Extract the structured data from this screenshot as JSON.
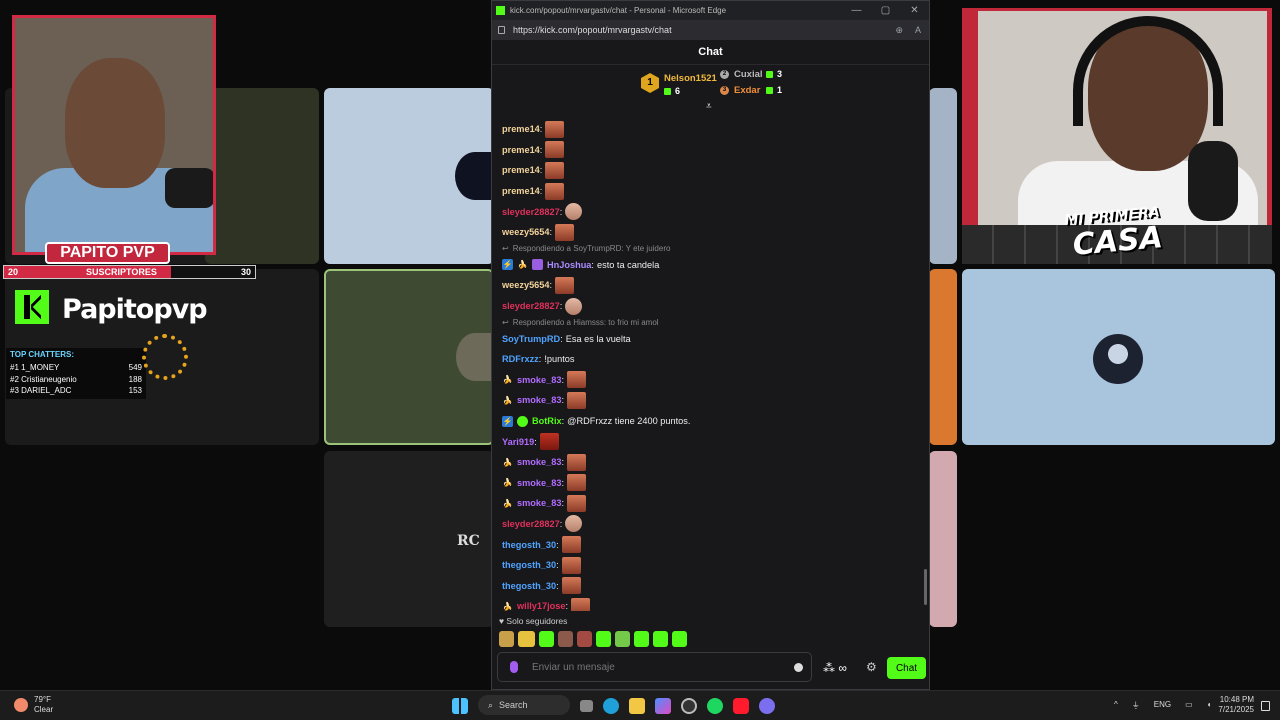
{
  "window": {
    "title": "kick.com/popout/mrvargastv/chat - Personal - Microsoft Edge",
    "url": "https://kick.com/popout/mrvargastv/chat",
    "controls": [
      "—",
      "▢",
      "✕"
    ]
  },
  "overlay": {
    "streamer_label": "PAPITO PVP",
    "sub_goal": {
      "current": "20",
      "label": "SUSCRIPTORES",
      "target": "30",
      "progress": 0.667
    },
    "kick_name": "Papitopvp",
    "top_chatters_title": "TOP CHATTERS:",
    "top_chatters": [
      {
        "rank": "#1",
        "name": "1_MONEY",
        "count": "549"
      },
      {
        "rank": "#2",
        "name": "Cristianeugenio",
        "count": "188"
      },
      {
        "rank": "#3",
        "name": "DARIEL_ADC",
        "count": "153"
      }
    ],
    "right_logo_line1": "MI PRIMERA",
    "right_logo_line2": "CASA",
    "tile_text": "RC"
  },
  "chat": {
    "title": "Chat",
    "leaderboard": {
      "first": {
        "rank": "1",
        "name": "Nelson1521",
        "gifts": "6"
      },
      "second": {
        "rank": "2",
        "name": "Cuxial",
        "gifts": "3"
      },
      "third": {
        "rank": "3",
        "name": "Exdar",
        "gifts": "1"
      }
    },
    "messages": [
      {
        "user": "preme14",
        "color": "#f2d39a",
        "text": "",
        "emote": "normal"
      },
      {
        "user": "preme14",
        "color": "#f2d39a",
        "text": "",
        "emote": "normal"
      },
      {
        "user": "preme14",
        "color": "#f2d39a",
        "text": "",
        "emote": "normal"
      },
      {
        "user": "preme14",
        "color": "#f2d39a",
        "text": "",
        "emote": "normal"
      },
      {
        "user": "sleyder28827",
        "color": "#e0315b",
        "text": "",
        "emote": "pale"
      },
      {
        "user": "weezy5654",
        "color": "#f2d39a",
        "text": "",
        "emote": "normal"
      },
      {
        "reply": "Respondiendo a SoyTrumpRD: Y ete juidero"
      },
      {
        "user": "HnJoshua",
        "color": "#a98cff",
        "text": "esto ta candela",
        "badges": [
          "blue",
          "yel",
          "pur"
        ]
      },
      {
        "user": "weezy5654",
        "color": "#f2d39a",
        "text": "",
        "emote": "normal"
      },
      {
        "user": "sleyder28827",
        "color": "#e0315b",
        "text": "",
        "emote": "pale"
      },
      {
        "reply": "Respondiendo a Hiamsss: to frio mi amol"
      },
      {
        "user": "SoyTrumpRD",
        "color": "#4fa3ff",
        "text": "Esa es la vuelta"
      },
      {
        "user": "RDFrxzz",
        "color": "#4fa3ff",
        "text": "!puntos"
      },
      {
        "user": "smoke_83",
        "color": "#b26cff",
        "text": "",
        "emote": "normal",
        "badges": [
          "yel"
        ]
      },
      {
        "user": "smoke_83",
        "color": "#b26cff",
        "text": "",
        "emote": "normal",
        "badges": [
          "yel"
        ]
      },
      {
        "user": "BotRix",
        "color": "#53fc18",
        "text": "@RDFrxzz tiene 2400 puntos.",
        "badges": [
          "blue",
          "grn"
        ]
      },
      {
        "user": "Yari919",
        "color": "#b26cff",
        "text": "",
        "emote": "red"
      },
      {
        "user": "smoke_83",
        "color": "#b26cff",
        "text": "",
        "emote": "normal",
        "badges": [
          "yel"
        ]
      },
      {
        "user": "smoke_83",
        "color": "#b26cff",
        "text": "",
        "emote": "normal",
        "badges": [
          "yel"
        ]
      },
      {
        "user": "smoke_83",
        "color": "#b26cff",
        "text": "",
        "emote": "normal",
        "badges": [
          "yel"
        ]
      },
      {
        "user": "sleyder28827",
        "color": "#e0315b",
        "text": "",
        "emote": "pale"
      },
      {
        "user": "thegosth_30",
        "color": "#4fa3ff",
        "text": "",
        "emote": "normal"
      },
      {
        "user": "thegosth_30",
        "color": "#4fa3ff",
        "text": "",
        "emote": "normal"
      },
      {
        "user": "thegosth_30",
        "color": "#4fa3ff",
        "text": "",
        "emote": "normal"
      },
      {
        "user": "willy17jose",
        "color": "#e0315b",
        "text": "",
        "emote": "normal",
        "badges": [
          "yel"
        ]
      }
    ],
    "followers_only": "Solo seguidores",
    "input_placeholder": "Enviar un mensaje",
    "send_label": "Chat",
    "infinity": "∞"
  },
  "taskbar": {
    "temp": "79°F",
    "condition": "Clear",
    "search_label": "Search",
    "lang": "ENG",
    "time": "10:48 PM",
    "date": "7/21/2025"
  },
  "colors": {
    "kick_green": "#53fc18",
    "accent_red": "#d22a44"
  }
}
